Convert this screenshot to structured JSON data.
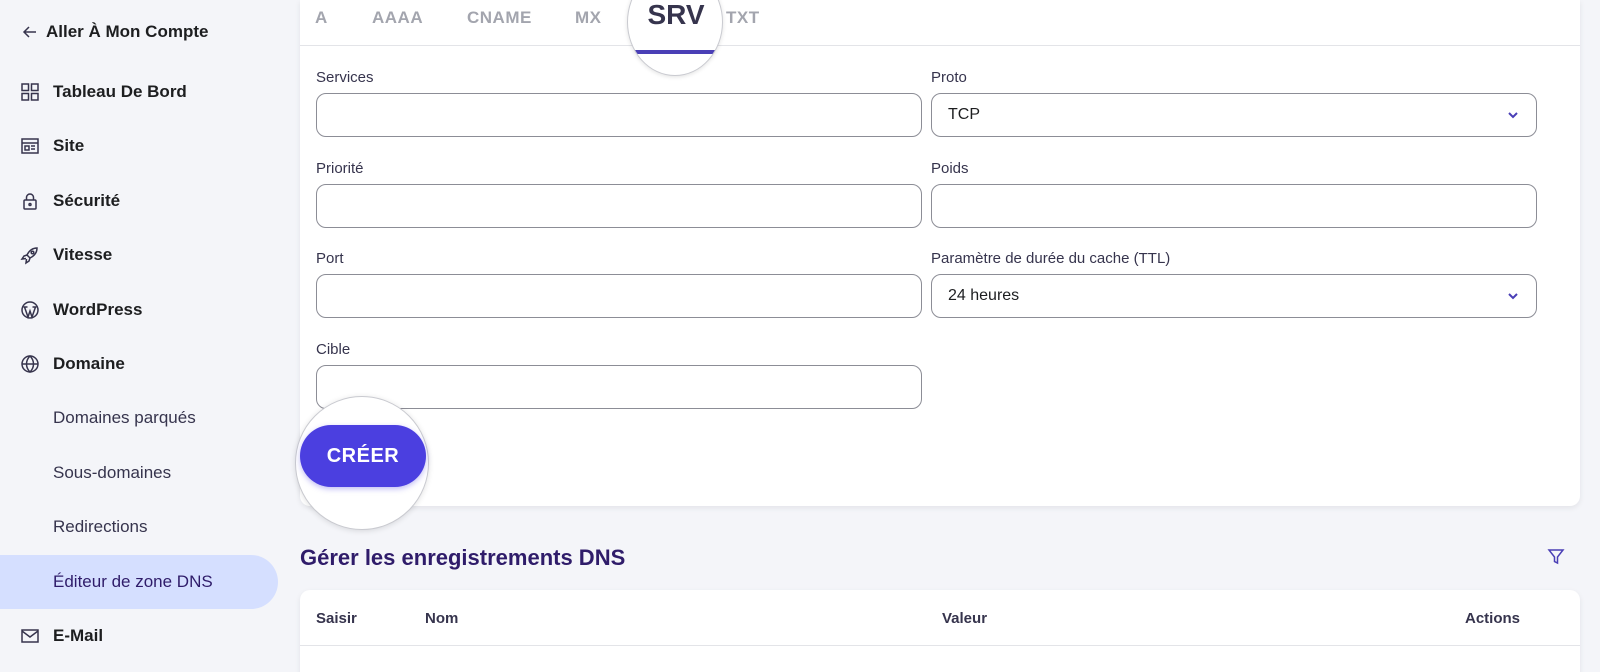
{
  "sidebar": {
    "back": {
      "label": "Aller À Mon Compte",
      "icon": "arrow-left-icon"
    },
    "items": [
      {
        "label": "Tableau De Bord",
        "icon": "grid-icon"
      },
      {
        "label": "Site",
        "icon": "browser-icon"
      },
      {
        "label": "Sécurité",
        "icon": "lock-icon"
      },
      {
        "label": "Vitesse",
        "icon": "rocket-icon"
      },
      {
        "label": "WordPress",
        "icon": "wordpress-icon"
      },
      {
        "label": "Domaine",
        "icon": "globe-icon"
      }
    ],
    "sub_items": [
      {
        "label": "Domaines parqués"
      },
      {
        "label": "Sous-domaines"
      },
      {
        "label": "Redirections"
      },
      {
        "label": "Éditeur de zone DNS",
        "active": true
      }
    ],
    "email": {
      "label": "E-Mail",
      "icon": "mail-icon"
    }
  },
  "tabs": {
    "items": [
      "A",
      "AAAA",
      "CNAME",
      "MX",
      "SRV",
      "TXT"
    ],
    "active": "SRV"
  },
  "form": {
    "services": {
      "label": "Services",
      "value": ""
    },
    "proto": {
      "label": "Proto",
      "value": "TCP"
    },
    "priorite": {
      "label": "Priorité",
      "value": ""
    },
    "poids": {
      "label": "Poids",
      "value": ""
    },
    "port": {
      "label": "Port",
      "value": ""
    },
    "ttl": {
      "label": "Paramètre de durée du cache (TTL)",
      "value": "24 heures"
    },
    "cible": {
      "label": "Cible",
      "value": ""
    },
    "submit_label": "CRÉER"
  },
  "records": {
    "title": "Gérer les enregistrements DNS",
    "columns": {
      "type": "Saisir",
      "name": "Nom",
      "value": "Valeur",
      "actions": "Actions"
    }
  },
  "colors": {
    "accent": "#4b3fe0",
    "active_nav_bg": "#d5dfff",
    "heading": "#2f1c6a"
  }
}
